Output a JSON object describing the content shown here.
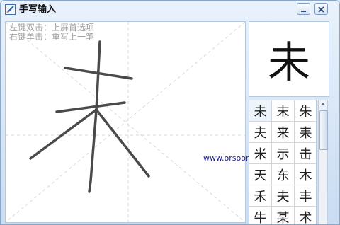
{
  "window": {
    "title": "手写输入"
  },
  "hints": [
    "左键双击：上屏首选项",
    "右键单击：重写上一笔"
  ],
  "preview_char": "未",
  "candidates": [
    "未",
    "末",
    "朱",
    "夫",
    "来",
    "耒",
    "米",
    "示",
    "击",
    "天",
    "东",
    "木",
    "禾",
    "夫",
    "丰",
    "牛",
    "某",
    "术"
  ],
  "watermark": "www.orsoon.com",
  "icons": {
    "app": "pen-icon",
    "minimize": "minimize-icon",
    "close": "close-icon"
  }
}
